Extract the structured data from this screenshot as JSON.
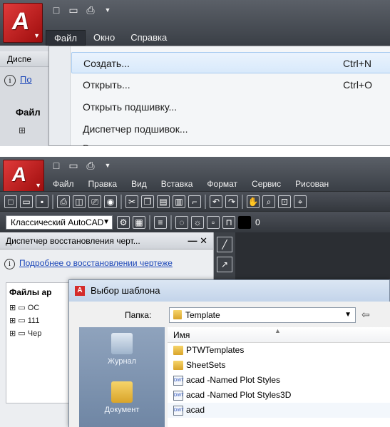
{
  "top_capture": {
    "quick_access": [
      "new-icon",
      "open-icon",
      "save-icon",
      "dropdown-icon"
    ],
    "menu": [
      "Файл",
      "Окно",
      "Справка"
    ],
    "palette_title": "Диспе",
    "info_link": "По",
    "files_header": "Файл",
    "file_menu": [
      {
        "label": "Создать...",
        "shortcut": "Ctrl+N"
      },
      {
        "label": "Открыть...",
        "shortcut": "Ctrl+O"
      },
      {
        "label": "Открыть подшивку...",
        "shortcut": ""
      },
      {
        "label": "Диспетчер подшивок...",
        "shortcut": ""
      },
      {
        "label": "В",
        "shortcut": ""
      }
    ]
  },
  "bottom_capture": {
    "menu": [
      "Файл",
      "Правка",
      "Вид",
      "Вставка",
      "Формат",
      "Сервис",
      "Рисован"
    ],
    "workspace": "Классический AutoCAD",
    "layer_value": "0",
    "recovery_panel": {
      "title": "Диспетчер восстановления черт...",
      "controls": "— ✕",
      "info_link": "Подробнее о восстановлении чертеже",
      "files_header": "Файлы ар",
      "tree": [
        "ОС",
        "111",
        "Чер"
      ]
    },
    "dialog": {
      "title": "Выбор шаблона",
      "folder_label": "Папка:",
      "folder_value": "Template",
      "column_name": "Имя",
      "places": [
        "Журнал",
        "Документ"
      ],
      "files": [
        {
          "name": "PTWTemplates",
          "kind": "folder"
        },
        {
          "name": "SheetSets",
          "kind": "folder"
        },
        {
          "name": "acad -Named Plot Styles",
          "kind": "dwt"
        },
        {
          "name": "acad -Named Plot Styles3D",
          "kind": "dwt"
        },
        {
          "name": "acad",
          "kind": "dwt"
        }
      ]
    }
  }
}
